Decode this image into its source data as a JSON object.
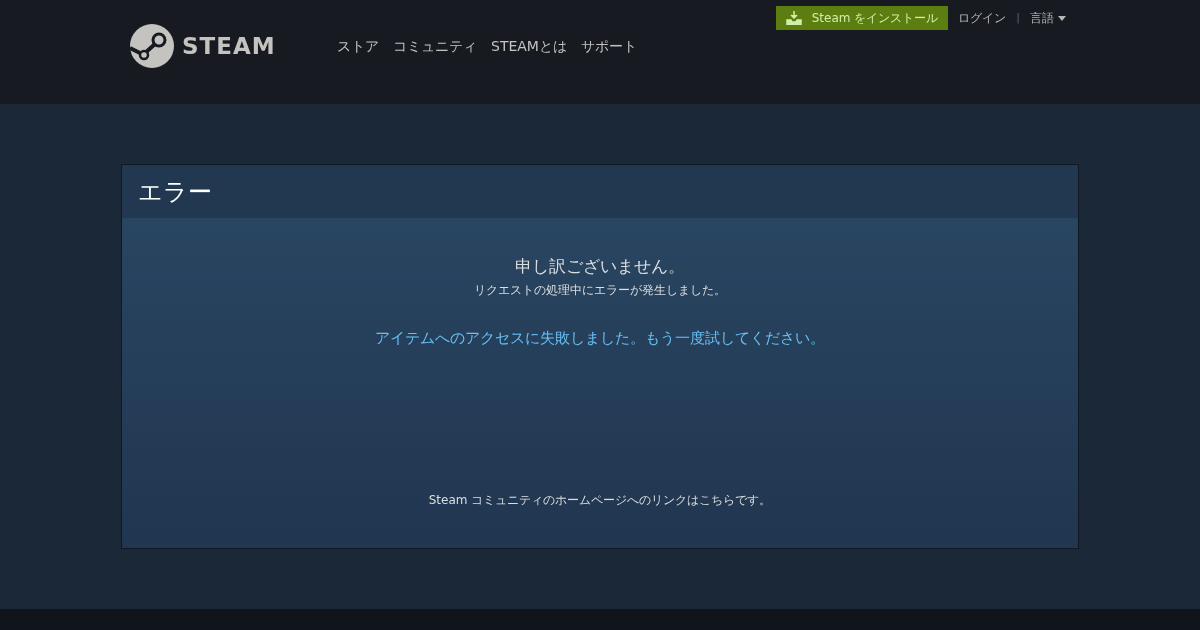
{
  "header": {
    "install_button": "Steam をインストール",
    "login": "ログイン",
    "separator": "|",
    "language": "言語",
    "logo_text": "STEAM",
    "nav": [
      "ストア",
      "コミュニティ",
      "STEAMとは",
      "サポート"
    ]
  },
  "error_panel": {
    "title": "エラー",
    "heading": "申し訳ございません。",
    "subheading": "リクエストの処理中にエラーが発生しました。",
    "message": "アイテムへのアクセスに失敗しました。もう一度試してください。",
    "footer_note": "Steam コミュニティのホームページへのリンクはこちらです。"
  }
}
